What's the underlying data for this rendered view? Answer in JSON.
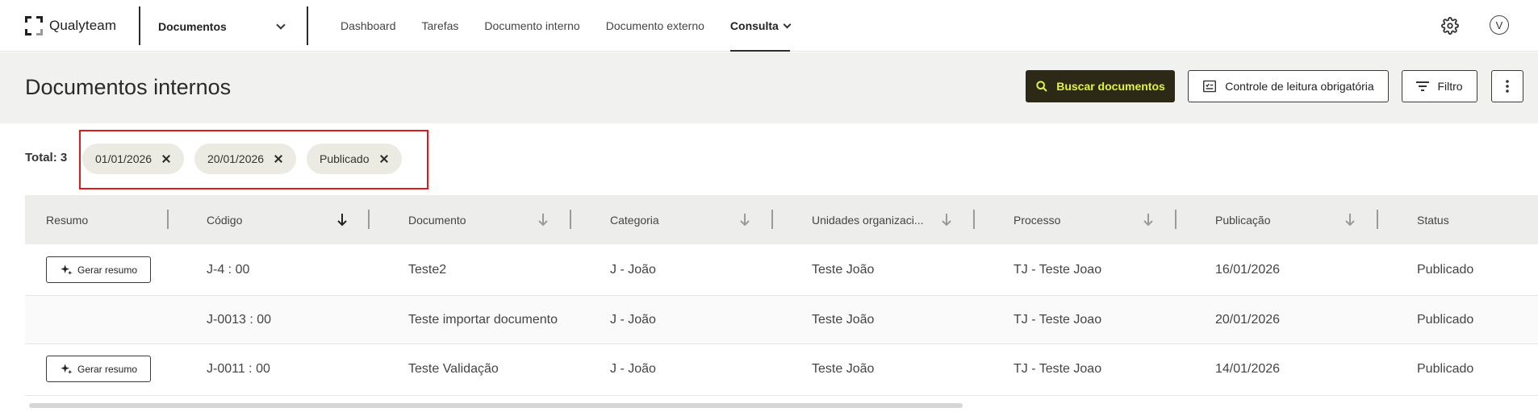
{
  "app": {
    "name": "Qualyteam"
  },
  "module": {
    "selected": "Documentos"
  },
  "nav": {
    "items": [
      {
        "label": "Dashboard"
      },
      {
        "label": "Tarefas"
      },
      {
        "label": "Documento interno"
      },
      {
        "label": "Documento externo"
      },
      {
        "label": "Consulta",
        "active": true
      }
    ]
  },
  "user": {
    "initial": "V"
  },
  "page": {
    "title": "Documentos internos",
    "buttons": {
      "search": "Buscar documentos",
      "reading_control": "Controle de leitura obrigatória",
      "filter": "Filtro"
    }
  },
  "filters": {
    "total_label": "Total: 3",
    "chips": [
      "01/01/2026",
      "20/01/2026",
      "Publicado"
    ]
  },
  "table": {
    "columns": [
      "Resumo",
      "Código",
      "Documento",
      "Categoria",
      "Unidades organizaci...",
      "Processo",
      "Publicação",
      "Status"
    ],
    "summary_button": "Gerar resumo",
    "rows": [
      {
        "has_summary_button": true,
        "codigo": "J-4 : 00",
        "documento": "Teste2",
        "categoria": "J - João",
        "unidades": "Teste João",
        "processo": "TJ - Teste Joao",
        "publicacao": "16/01/2026",
        "status": "Publicado"
      },
      {
        "has_summary_button": false,
        "codigo": "J-0013 : 00",
        "documento": "Teste importar documento",
        "categoria": "J - João",
        "unidades": "Teste João",
        "processo": "TJ - Teste Joao",
        "publicacao": "20/01/2026",
        "status": "Publicado"
      },
      {
        "has_summary_button": true,
        "codigo": "J-0011 : 00",
        "documento": "Teste Validação",
        "categoria": "J - João",
        "unidades": "Teste João",
        "processo": "TJ - Teste Joao",
        "publicacao": "14/01/2026",
        "status": "Publicado"
      }
    ]
  },
  "colors": {
    "primary_bg": "#2c2a17",
    "primary_text": "#e4f23a",
    "chip_bg": "#ebebe3",
    "highlight": "#e01a1a"
  }
}
